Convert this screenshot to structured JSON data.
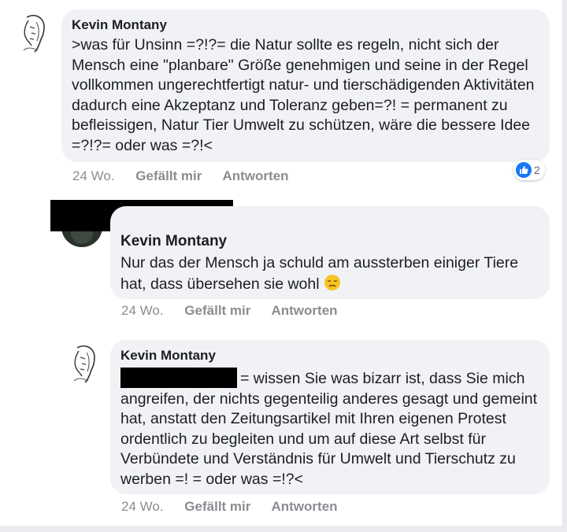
{
  "comments": [
    {
      "author": "Kevin Montany",
      "text": ">was für Unsinn =?!?= die Natur sollte es regeln, nicht sich der Mensch eine \"planbare\" Größe genehmigen und seine in der Regel vollkommen ungerechtfertigt natur- und tierschädigenden Aktivitäten dadurch eine Akzeptanz und Toleranz geben=?! = permanent zu befleissigen, Natur Tier Umwelt zu schützen, wäre die bessere Idee =?!?= oder was =?!<",
      "time": "24 Wo.",
      "like_label": "Gefällt mir",
      "reply_label": "Antworten",
      "reaction_count": "2",
      "reaction_icon": "thumbs-up-icon"
    },
    {
      "author": "Kevin Montany",
      "text": "Nur das der Mensch ja schuld am aussterben einiger Tiere hat, dass übersehen sie wohl",
      "emoji": "disappointed-face-icon",
      "time": "24 Wo.",
      "like_label": "Gefällt mir",
      "reply_label": "Antworten"
    },
    {
      "author": "Kevin Montany",
      "text": "= wissen Sie was bizarr ist, dass Sie mich angreifen, der nichts gegenteilig anderes gesagt und gemeint hat, anstatt den Zeitungsartikel mit Ihren eigenen Protest ordentlich zu begleiten und um auf diese Art selbst für Verbündete und Verständnis für Umwelt und Tierschutz zu werben =! = oder was =!?<",
      "time": "24 Wo.",
      "like_label": "Gefällt mir",
      "reply_label": "Antworten"
    }
  ],
  "colors": {
    "bubble": "#f0f2f5",
    "text": "#1c1e21",
    "meta": "#8a8d91",
    "like_blue": "#1877f2",
    "redaction": "#000000"
  }
}
